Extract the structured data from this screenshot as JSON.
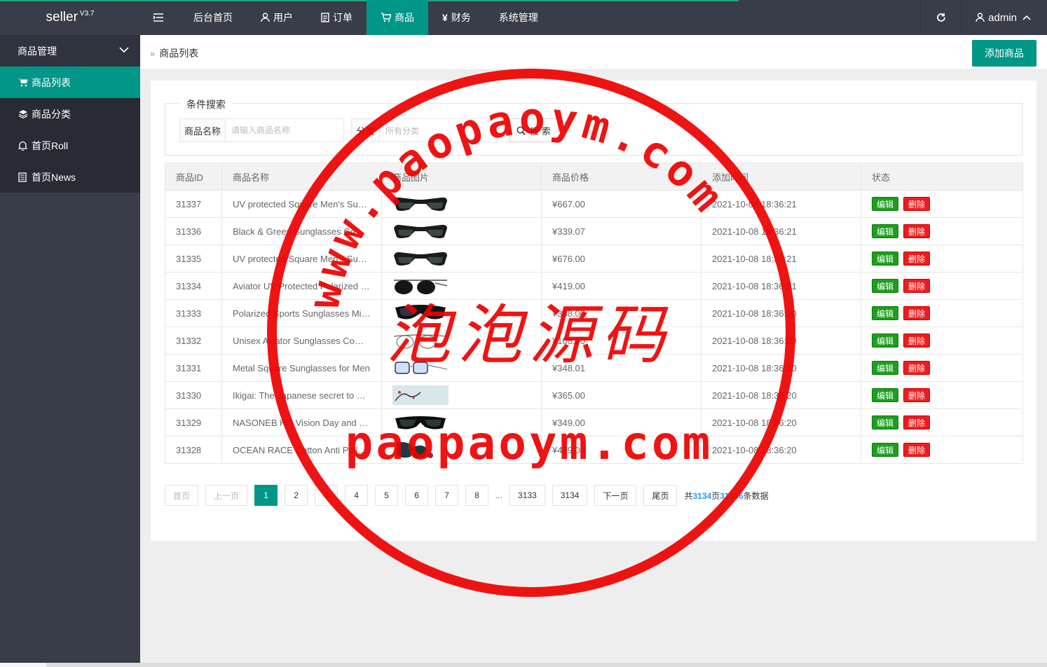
{
  "app": {
    "name": "seller",
    "version": "V3.7"
  },
  "topnav": [
    {
      "label": "后台首页",
      "icon": ""
    },
    {
      "label": "用户",
      "icon": "user-icon"
    },
    {
      "label": "订单",
      "icon": "document-icon"
    },
    {
      "label": "商品",
      "icon": "cart-icon"
    },
    {
      "label": "财务",
      "icon": "yen-icon"
    },
    {
      "label": "系统管理",
      "icon": ""
    }
  ],
  "user": {
    "name": "admin"
  },
  "sidebar": {
    "group_label": "商品管理",
    "items": [
      {
        "label": "商品列表",
        "icon": "cart-icon"
      },
      {
        "label": "商品分类",
        "icon": "layers-icon"
      },
      {
        "label": "首页Roll",
        "icon": "bell-icon"
      },
      {
        "label": "首页News",
        "icon": "news-icon"
      }
    ]
  },
  "breadcrumb": "商品列表",
  "add_button": "添加商品",
  "search": {
    "legend": "条件搜索",
    "name_label": "商品名称",
    "name_placeholder": "请输入商品名称",
    "category_label": "分类",
    "category_value": "所有分类",
    "button": "搜 索"
  },
  "table": {
    "headers": [
      "商品ID",
      "商品名称",
      "商品图片",
      "商品价格",
      "添加时间",
      "状态"
    ],
    "edit_label": "编辑",
    "delete_label": "删除",
    "rows": [
      {
        "id": "31337",
        "name": "UV protected Square Men's Sunglasses",
        "price": "¥667.00",
        "time": "2021-10-08 18:36:21",
        "img": "sunglasses"
      },
      {
        "id": "31336",
        "name": "Black & Green Sunglasses Combo",
        "price": "¥339.07",
        "time": "2021-10-08 18:36:21",
        "img": "sunglasses"
      },
      {
        "id": "31335",
        "name": "UV protected Square Men's Sunglasses",
        "price": "¥676.00",
        "time": "2021-10-08 18:36:21",
        "img": "sunglasses"
      },
      {
        "id": "31334",
        "name": "Aviator UV Protected Polarized Sunglasses",
        "price": "¥419.00",
        "time": "2021-10-08 18:36:21",
        "img": "aviator"
      },
      {
        "id": "31333",
        "name": "Polarized Sports Sunglasses Mirrored",
        "price": "¥388.00",
        "time": "2021-10-08 18:36:20",
        "img": "sport"
      },
      {
        "id": "31332",
        "name": "Unisex Aviator Sunglasses Combo",
        "price": "¥108.00",
        "time": "2021-10-08 18:36:20",
        "img": "wire"
      },
      {
        "id": "31331",
        "name": "Metal Square Sunglasses for Men",
        "price": "¥348.01",
        "time": "2021-10-08 18:36:20",
        "img": "clear"
      },
      {
        "id": "31330",
        "name": "Ikigai: The Japanese secret to a long and happy life",
        "price": "¥365.00",
        "time": "2021-10-08 18:36:20",
        "img": "book"
      },
      {
        "id": "31329",
        "name": "NASONEB HD Vision Day and Night",
        "price": "¥349.00",
        "time": "2021-10-08 18:36:20",
        "img": "wrap"
      },
      {
        "id": "31328",
        "name": "OCEAN RACE Cotton Anti Pollution",
        "price": "¥499.00",
        "time": "2021-10-08 18:36:20",
        "img": "mask"
      }
    ]
  },
  "pagination": {
    "first": "首页",
    "prev": "上一页",
    "pages": [
      "1",
      "2",
      "3",
      "4",
      "5",
      "6",
      "7",
      "8"
    ],
    "current": "1",
    "ellipsis": "...",
    "last_pages": [
      "3133",
      "3134"
    ],
    "next": "下一页",
    "last": "尾页",
    "total_prefix": "共",
    "total_pages": "3134",
    "total_mid": "页",
    "total_items": "31336",
    "total_suffix": "条数据"
  },
  "watermark": {
    "ring_text": "www.paopaoym.com",
    "center_text": "泡泡源码",
    "bottom_text": "paopaoym.com",
    "color": "#ee0000"
  },
  "colors": {
    "header": "#393d49",
    "accent": "#009688",
    "edit": "#1e9e1e",
    "delete": "#ee1d1d",
    "link": "#1e9fff"
  }
}
